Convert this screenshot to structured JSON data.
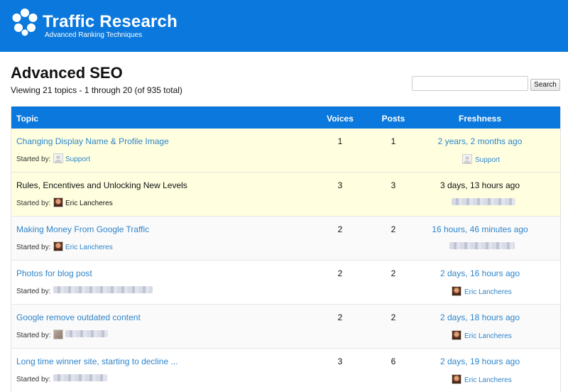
{
  "brand": {
    "title": "Traffic Research",
    "subtitle": "Advanced Ranking Techniques",
    "icon": "paw-flower-logo-icon",
    "color": "#0a78dc"
  },
  "page": {
    "title": "Advanced SEO",
    "viewing": "Viewing 21 topics - 1 through 20 (of 935 total)"
  },
  "search": {
    "value": "",
    "placeholder": "",
    "button_label": "Search"
  },
  "table": {
    "headers": {
      "topic": "Topic",
      "voices": "Voices",
      "posts": "Posts",
      "freshness": "Freshness"
    },
    "started_by_label": "Started by:",
    "rows": [
      {
        "title": "Changing Display Name & Profile Image",
        "author": "Support",
        "voices": "1",
        "posts": "1",
        "freshness": "2 years, 2 months ago",
        "last_author": "Support",
        "sticky": true
      },
      {
        "title": "Rules, Encentives and Unlocking New Levels",
        "author": "Eric Lancheres",
        "voices": "3",
        "posts": "3",
        "freshness": "3 days, 13 hours ago",
        "last_author": "",
        "sticky": true
      },
      {
        "title": "Making Money From Google Traffic",
        "author": "Eric Lancheres",
        "voices": "2",
        "posts": "2",
        "freshness": "16 hours, 46 minutes ago",
        "last_author": ""
      },
      {
        "title": "Photos for blog post",
        "author": "",
        "voices": "2",
        "posts": "2",
        "freshness": "2 days, 16 hours ago",
        "last_author": "Eric Lancheres"
      },
      {
        "title": "Google remove outdated content",
        "author": "",
        "voices": "2",
        "posts": "2",
        "freshness": "2 days, 18 hours ago",
        "last_author": "Eric Lancheres"
      },
      {
        "title": "Long time winner site, starting to decline ...",
        "author": "",
        "voices": "3",
        "posts": "6",
        "freshness": "2 days, 19 hours ago",
        "last_author": "Eric Lancheres"
      }
    ]
  }
}
